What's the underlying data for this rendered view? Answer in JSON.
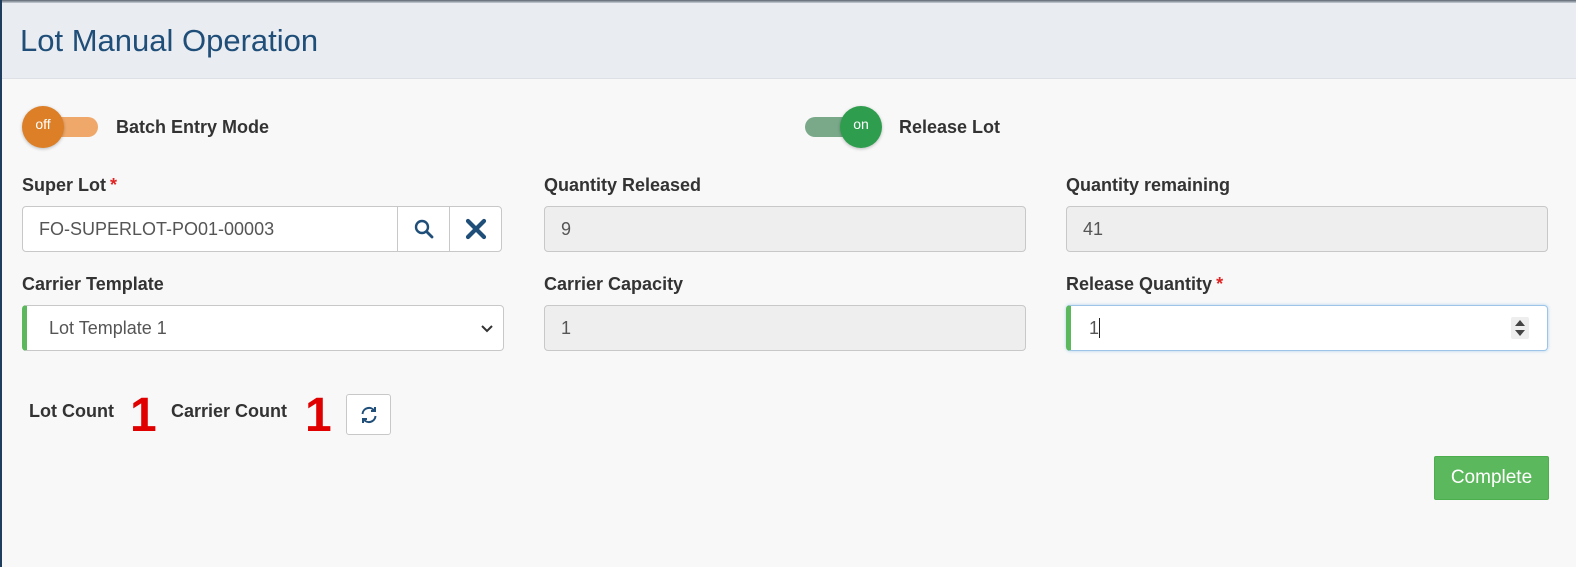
{
  "header": {
    "title": "Lot Manual Operation"
  },
  "toggles": {
    "batch_entry": {
      "state_text": "off",
      "label": "Batch Entry Mode",
      "color": "#e08a2a",
      "track": "#f0a86a"
    },
    "release_lot": {
      "state_text": "on",
      "label": "Release Lot",
      "color": "#2e9e4e",
      "track": "#7aa98a"
    }
  },
  "fields": {
    "super_lot": {
      "label": "Super Lot",
      "required": "*",
      "value": "FO-SUPERLOT-PO01-00003"
    },
    "quantity_released": {
      "label": "Quantity Released",
      "value": "9"
    },
    "quantity_remaining": {
      "label": "Quantity remaining",
      "value": "41"
    },
    "carrier_template": {
      "label": "Carrier Template",
      "value": "Lot Template 1"
    },
    "carrier_capacity": {
      "label": "Carrier Capacity",
      "value": "1"
    },
    "release_quantity": {
      "label": "Release Quantity",
      "required": "*",
      "value": "1"
    }
  },
  "counts": {
    "lot_count": {
      "label": "Lot Count",
      "value": "1"
    },
    "carrier_count": {
      "label": "Carrier Count",
      "value": "1"
    }
  },
  "actions": {
    "complete": "Complete"
  },
  "icons": {
    "search": "search-icon",
    "clear": "close-icon",
    "refresh": "refresh-icon",
    "dropdown": "chevron-down-icon"
  }
}
